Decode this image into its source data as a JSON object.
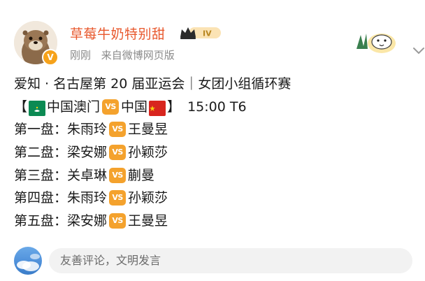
{
  "post": {
    "username": "草莓牛奶特别甜",
    "level_badge": "IV",
    "time": "刚刚",
    "source": "来自微博网页版",
    "verified_mark": "V"
  },
  "content": {
    "title": "爱知 · 名古屋第 20 届亚运会｜女团小组循环赛",
    "match": {
      "open": "【",
      "team_a": "中国澳门",
      "vs": "VS",
      "team_b": "中国",
      "close": "】",
      "time": "15:00 T6"
    },
    "games": [
      {
        "label": "第一盘：",
        "a": "朱雨玲",
        "vs": "VS",
        "b": "王曼昱"
      },
      {
        "label": "第二盘：",
        "a": "梁安娜",
        "vs": "VS",
        "b": "孙颖莎"
      },
      {
        "label": "第三盘：",
        "a": "关卓琳",
        "vs": "VS",
        "b": "蒯曼"
      },
      {
        "label": "第四盘：",
        "a": "朱雨玲",
        "vs": "VS",
        "b": "孙颖莎"
      },
      {
        "label": "第五盘：",
        "a": "梁安娜",
        "vs": "VS",
        "b": "王曼昱"
      }
    ]
  },
  "comment": {
    "placeholder": "友善评论，文明发言"
  },
  "colors": {
    "username": "#e8582d",
    "vs_badge": "#f4a22d",
    "verified": "#f6a21a",
    "macau_flag": "#0b8a53",
    "china_flag": "#d8251e"
  },
  "icons": {
    "avatar": "otter-avatar",
    "level": "crown-level-badge",
    "decoration": "cartoon-bird-decoration",
    "more": "chevron-down-icon",
    "comment_avatar": "sky-avatar"
  }
}
